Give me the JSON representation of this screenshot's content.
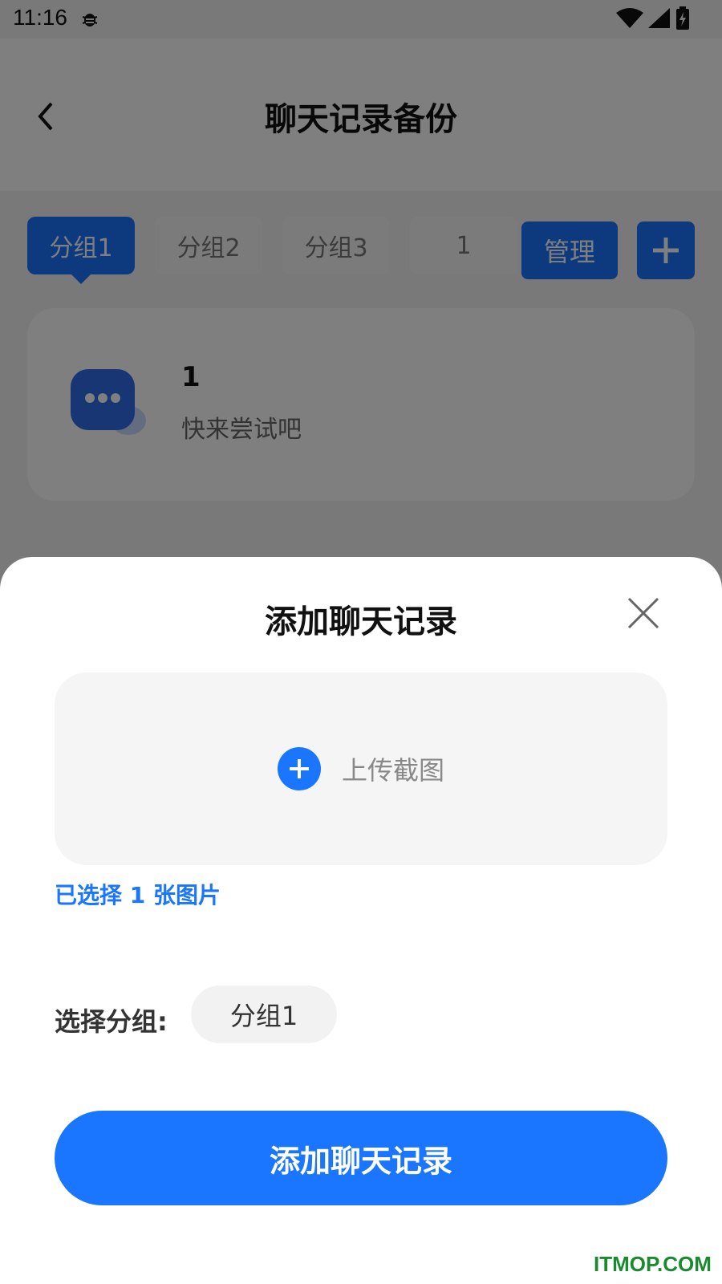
{
  "status_bar": {
    "time": "11:16"
  },
  "header": {
    "title": "聊天记录备份"
  },
  "tabs": [
    {
      "label": "分组1",
      "active": true
    },
    {
      "label": "分组2",
      "active": false
    },
    {
      "label": "分组3",
      "active": false
    },
    {
      "label": "1",
      "active": false
    }
  ],
  "toolbar": {
    "manage_label": "管理"
  },
  "record": {
    "title": "1",
    "subtitle": "快来尝试吧"
  },
  "sheet": {
    "title": "添加聊天记录",
    "upload_label": "上传截图",
    "selected_text": "已选择 1 张图片",
    "group_label": "选择分组:",
    "group_value": "分组1",
    "submit_label": "添加聊天记录"
  },
  "watermark": "ITMOP.COM",
  "colors": {
    "accent": "#1a75ff",
    "watermark": "#1a8a2e"
  }
}
